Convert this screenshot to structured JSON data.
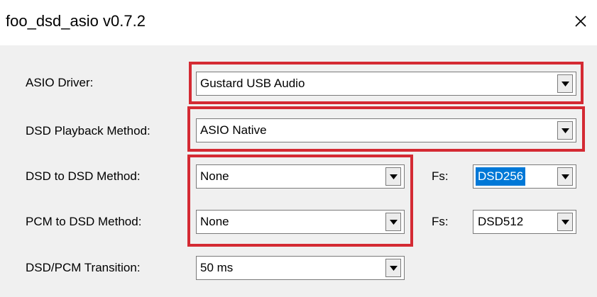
{
  "window": {
    "title": "foo_dsd_asio v0.7.2"
  },
  "icons": {
    "close": "close-icon",
    "dropdown": "chevron-down-icon"
  },
  "colors": {
    "highlight": "#d42a33",
    "selection": "#0078d7",
    "client_bg": "#f0f0f0"
  },
  "fields": {
    "asio_driver": {
      "label": "ASIO Driver:",
      "value": "Gustard USB Audio"
    },
    "dsd_playback_method": {
      "label": "DSD Playback Method:",
      "value": "ASIO Native"
    },
    "dsd_to_dsd_method": {
      "label": "DSD to DSD Method:",
      "value": "None"
    },
    "dsd_to_dsd_fs": {
      "label": "Fs:",
      "value": "DSD256"
    },
    "pcm_to_dsd_method": {
      "label": "PCM to DSD Method:",
      "value": "None"
    },
    "pcm_to_dsd_fs": {
      "label": "Fs:",
      "value": "DSD512"
    },
    "dsd_pcm_transition": {
      "label": "DSD/PCM Transition:",
      "value": "50 ms"
    }
  }
}
